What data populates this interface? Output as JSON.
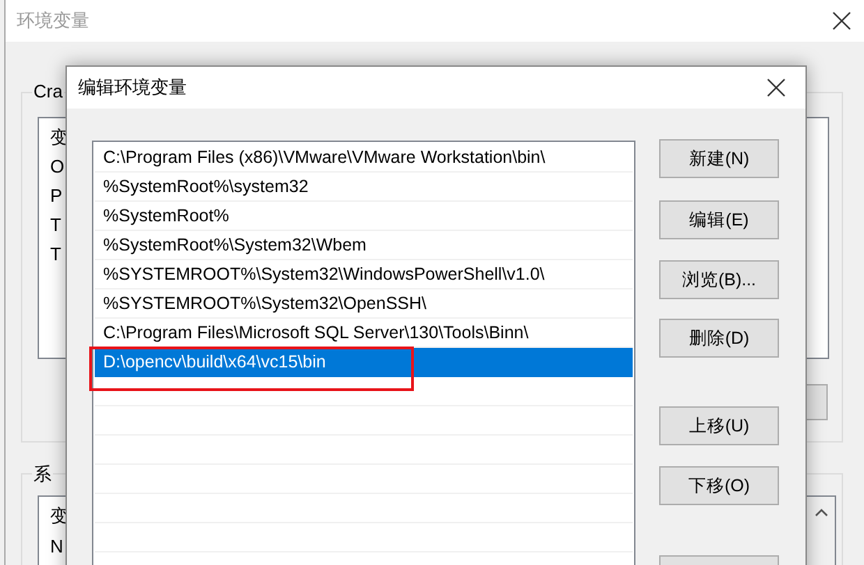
{
  "background_window": {
    "title": "环境变量",
    "user_group": {
      "label": "Cra",
      "rows": [
        "变",
        "O",
        "P",
        "T",
        "T"
      ]
    },
    "system_group": {
      "label": "系",
      "rows": [
        "变",
        "N"
      ]
    }
  },
  "dialog": {
    "title": "编辑环境变量",
    "paths": [
      {
        "text": "C:\\Program Files (x86)\\VMware\\VMware Workstation\\bin\\",
        "selected": false
      },
      {
        "text": "%SystemRoot%\\system32",
        "selected": false
      },
      {
        "text": "%SystemRoot%",
        "selected": false
      },
      {
        "text": "%SystemRoot%\\System32\\Wbem",
        "selected": false
      },
      {
        "text": "%SYSTEMROOT%\\System32\\WindowsPowerShell\\v1.0\\",
        "selected": false
      },
      {
        "text": "%SYSTEMROOT%\\System32\\OpenSSH\\",
        "selected": false
      },
      {
        "text": "C:\\Program Files\\Microsoft SQL Server\\130\\Tools\\Binn\\",
        "selected": false
      },
      {
        "text": "D:\\opencv\\build\\x64\\vc15\\bin",
        "selected": true
      }
    ],
    "buttons": [
      {
        "label": "新建(N)"
      },
      {
        "label": "编辑(E)"
      },
      {
        "label": "浏览(B)..."
      },
      {
        "label": "删除(D)"
      },
      {
        "label": "上移(U)"
      },
      {
        "label": "下移(O)"
      }
    ]
  }
}
